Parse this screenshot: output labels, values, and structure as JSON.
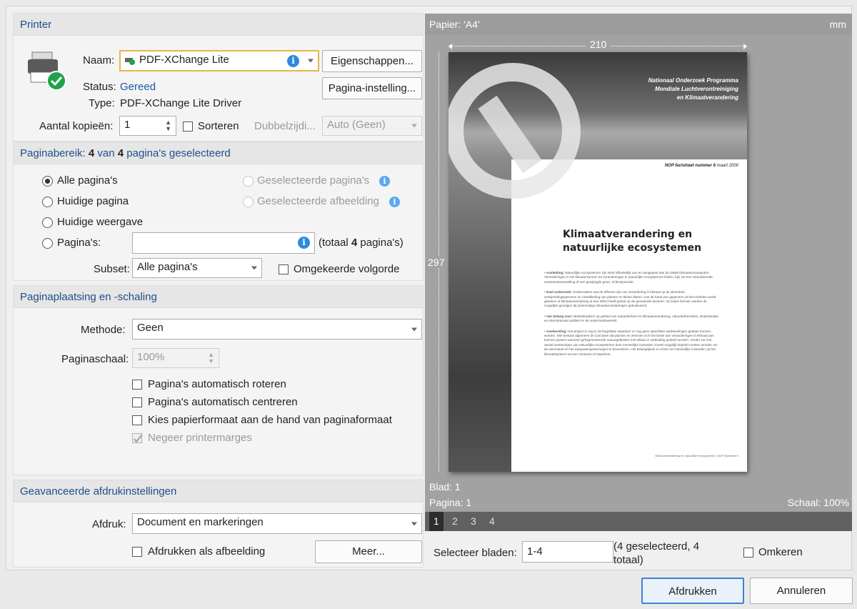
{
  "printer": {
    "title": "Printer",
    "name_label": "Naam:",
    "name_value": "PDF-XChange Lite",
    "properties_button": "Eigenschappen...",
    "page_setup_button": "Pagina-instelling...",
    "status_label": "Status:",
    "status_value": "Gereed",
    "type_label": "Type:",
    "type_value": "PDF-XChange Lite Driver",
    "copies_label": "Aantal kopieën:",
    "copies_value": "1",
    "collate_label": "Sorteren",
    "duplex_label": "Dubbelzijdi...",
    "duplex_value": "Auto (Geen)"
  },
  "range": {
    "title_prefix": "Paginabereik:",
    "selected": "4",
    "of": "van",
    "total": "4",
    "title_suffix": "pagina's geselecteerd",
    "all_pages": "Alle pagina's",
    "current_page": "Huidige pagina",
    "current_view": "Huidige weergave",
    "pages": "Pagina's:",
    "pages_value": "",
    "total_prefix": "(totaal",
    "total_count": "4",
    "total_suffix": "pagina's)",
    "selected_pages": "Geselecteerde pagina's",
    "selected_image": "Geselecteerde afbeelding",
    "subset_label": "Subset:",
    "subset_value": "Alle pagina's",
    "reverse_label": "Omgekeerde volgorde"
  },
  "placement": {
    "title": "Paginaplaatsing en -schaling",
    "method_label": "Methode:",
    "method_value": "Geen",
    "scale_label": "Paginaschaal:",
    "scale_value": "100%",
    "auto_rotate": "Pagina's automatisch roteren",
    "auto_center": "Pagina's automatisch centreren",
    "paper_by_page": "Kies papierformaat aan de hand van paginaformaat",
    "ignore_margins": "Negeer printermarges"
  },
  "advanced": {
    "title": "Geavanceerde afdrukinstellingen",
    "print_label": "Afdruk:",
    "print_value": "Document en markeringen",
    "as_image": "Afdrukken als afbeelding",
    "more_button": "Meer..."
  },
  "preview": {
    "paper": "Papier: 'A4'",
    "unit": "mm",
    "width": "210",
    "height": "297",
    "sheet": "Blad: 1",
    "page": "Pagina: 1",
    "scale": "Schaal: 100%",
    "pages": [
      "1",
      "2",
      "3",
      "4"
    ],
    "select_label": "Selecteer bladen:",
    "select_value": "1-4",
    "select_info": "(4 geselecteerd, 4 totaal)",
    "invert_label": "Omkeren",
    "doc": {
      "header_lines": [
        "Nationaal Onderzoek Programma",
        "Mondiale Luchtverontreiniging",
        "en Klimaatverandering"
      ],
      "factsheet": "NOP factsheet nummer 6",
      "date": "maart 2000",
      "title_line1": "Klimaatverandering en",
      "title_line2": "natuurlijke ecosystemen",
      "bullets": [
        {
          "head": "Aanleiding:",
          "text": "Natuurlijke ecosystemen zijn sterk afhankelijk van en aangepast aan de lokale klimaatvoorwaarden. Veranderingen in het klimaat kunnen tot veranderingen in natuurlijke ecosystemen leiden, bijv. tot een veranderende soortensamenstelling of een gewijzigde groei- of bloeiperiode."
        },
        {
          "head": "Doel onderzoek:",
          "text": "Onderzoeken wat de effecten zijn van verandering in klimaat op de diversiteit, verspreidingspatronen en ontwikkeling van planten en kleine dieren. Aan de hand van gegevens uit het verleden wordt gekeken of klimaatverandering al een effect heeft gehad op de genoemde factoren. Op basis hiervan worden de mogelijke gevolgen bij toekomstige klimaatveranderingen geëvalueerd."
        },
        {
          "head": "Van belang voor:",
          "text": "Beleidsmakers op gebied van natuurbeheer en klimaatverandering, natuurbeheerders, Nederlandse en internationale publiek en de onderzoekswereld."
        },
        {
          "head": "Aanbeveling:",
          "text": "Het project is nog in de beginfase waardoor er nog geen specifieke aanbevelingen gedaan kunnen worden. Wel bestaat algemeen de conclusie dat planten en insecten zich het beste aan veranderingen in klimaat aan kunnen passen wanneer gefragmenteerde natuurgebieden met elkaar in verbinding gesteld worden. Verder zou het aantal verstoringen van natuurlijke ecosystemen door menselijke invloeden zoveel mogelijk beperkt moeten worden om de weerstand en het aanpassingsvermogen te bevorderen. Het belangrijkste is echter om menselijke invloeden op het klimaatsysteem tot een minimum te beperken."
        }
      ],
      "footer": "Klimaatverandering en natuurlijke ecosystemen | NOP factsheet 6"
    }
  },
  "actions": {
    "print": "Afdrukken",
    "cancel": "Annuleren"
  },
  "colors": {
    "accent": "#1e5aa8",
    "info": "#2b8be0",
    "status_ok": "#1ea34b"
  }
}
